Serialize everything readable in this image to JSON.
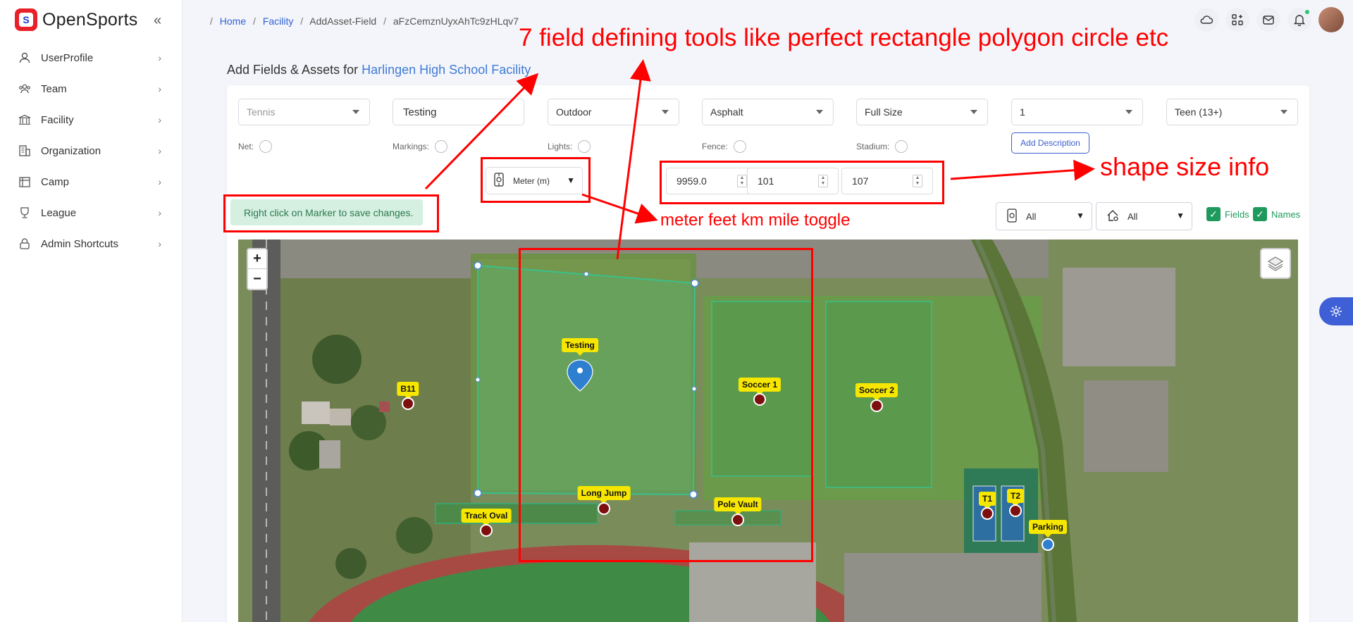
{
  "brand": {
    "name": "OpenSports",
    "logo_letter": "S"
  },
  "sidebar": {
    "items": [
      {
        "label": "UserProfile",
        "icon": "user-icon"
      },
      {
        "label": "Team",
        "icon": "team-icon"
      },
      {
        "label": "Facility",
        "icon": "facility-icon"
      },
      {
        "label": "Organization",
        "icon": "organization-icon"
      },
      {
        "label": "Camp",
        "icon": "camp-icon"
      },
      {
        "label": "League",
        "icon": "league-icon"
      },
      {
        "label": "Admin Shortcuts",
        "icon": "lock-icon"
      }
    ]
  },
  "breadcrumb": {
    "home": "Home",
    "facility": "Facility",
    "page": "AddAsset-Field",
    "id": "aFzCemznUyxAhTc9zHLqv7"
  },
  "page": {
    "title_prefix": "Add Fields & Assets for",
    "facility_name": "Harlingen High School Facility"
  },
  "form": {
    "sport": {
      "placeholder": "Tennis"
    },
    "name": {
      "value": "Testing"
    },
    "environment": {
      "value": "Outdoor"
    },
    "surface": {
      "value": "Asphalt"
    },
    "size": {
      "value": "Full Size"
    },
    "count": {
      "value": "1"
    },
    "age": {
      "value": "Teen (13+)"
    },
    "toggles": {
      "net": "Net:",
      "markings": "Markings:",
      "lights": "Lights:",
      "fence": "Fence:",
      "stadium": "Stadium:"
    },
    "add_description": "Add Description",
    "unit": {
      "value": "Meter (m)"
    },
    "dimensions": {
      "area": "9959.0",
      "length": "101",
      "width": "107"
    },
    "notice": "Right click on Marker to save changes."
  },
  "filters": {
    "field_filter": "All",
    "asset_filter": "All",
    "fields_label": "Fields",
    "names_label": "Names"
  },
  "map": {
    "markers": [
      {
        "label": "Testing",
        "type": "active"
      },
      {
        "label": "B11"
      },
      {
        "label": "Soccer 1"
      },
      {
        "label": "Soccer 2"
      },
      {
        "label": "Long Jump"
      },
      {
        "label": "Pole Vault"
      },
      {
        "label": "Track Oval"
      },
      {
        "label": "T1"
      },
      {
        "label": "T2"
      },
      {
        "label": "Parking"
      }
    ]
  },
  "annotations": {
    "title": "7 field defining tools like perfect rectangle polygon circle etc",
    "unit_toggle": "meter feet km mile toggle",
    "size_info": "shape size info",
    "color": "#ff0000"
  },
  "colors": {
    "brand_red": "#e8202a",
    "link_blue": "#2f5fd6",
    "success_green": "#1e9a5c",
    "marker_yellow": "#f6e600",
    "marker_red": "#7d0f0f"
  }
}
